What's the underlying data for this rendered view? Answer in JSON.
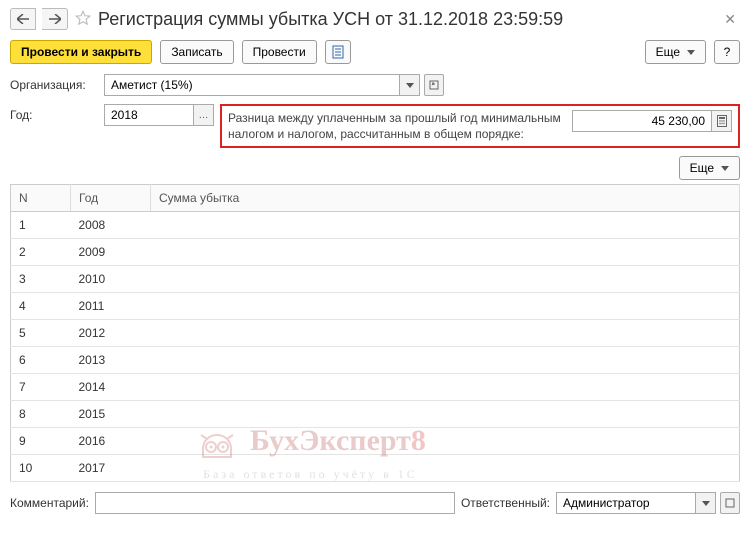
{
  "titlebar": {
    "title": "Регистрация суммы убытка УСН от 31.12.2018 23:59:59"
  },
  "toolbar": {
    "post_close": "Провести и закрыть",
    "write": "Записать",
    "post": "Провести",
    "more": "Еще",
    "help": "?"
  },
  "form": {
    "org_label": "Организация:",
    "org_value": "Аметист (15%)",
    "year_label": "Год:",
    "year_value": "2018",
    "diff_label_l1": "Разница между уплаченным за прошлый год минимальным",
    "diff_label_l2": "налогом и налогом, рассчитанным в общем порядке:",
    "diff_value": "45 230,00"
  },
  "table": {
    "more": "Еще",
    "headers": {
      "n": "N",
      "year": "Год",
      "sum": "Сумма убытка"
    },
    "rows": [
      {
        "n": "1",
        "year": "2008",
        "sum": ""
      },
      {
        "n": "2",
        "year": "2009",
        "sum": ""
      },
      {
        "n": "3",
        "year": "2010",
        "sum": ""
      },
      {
        "n": "4",
        "year": "2011",
        "sum": ""
      },
      {
        "n": "5",
        "year": "2012",
        "sum": ""
      },
      {
        "n": "6",
        "year": "2013",
        "sum": ""
      },
      {
        "n": "7",
        "year": "2014",
        "sum": ""
      },
      {
        "n": "8",
        "year": "2015",
        "sum": ""
      },
      {
        "n": "9",
        "year": "2016",
        "sum": ""
      },
      {
        "n": "10",
        "year": "2017",
        "sum": ""
      }
    ]
  },
  "footer": {
    "comment_label": "Комментарий:",
    "comment_value": "",
    "responsible_label": "Ответственный:",
    "responsible_value": "Администратор"
  },
  "watermark": {
    "big": "БухЭксперт",
    "eight": "8",
    "sub": "База ответов по учёту в 1С"
  }
}
